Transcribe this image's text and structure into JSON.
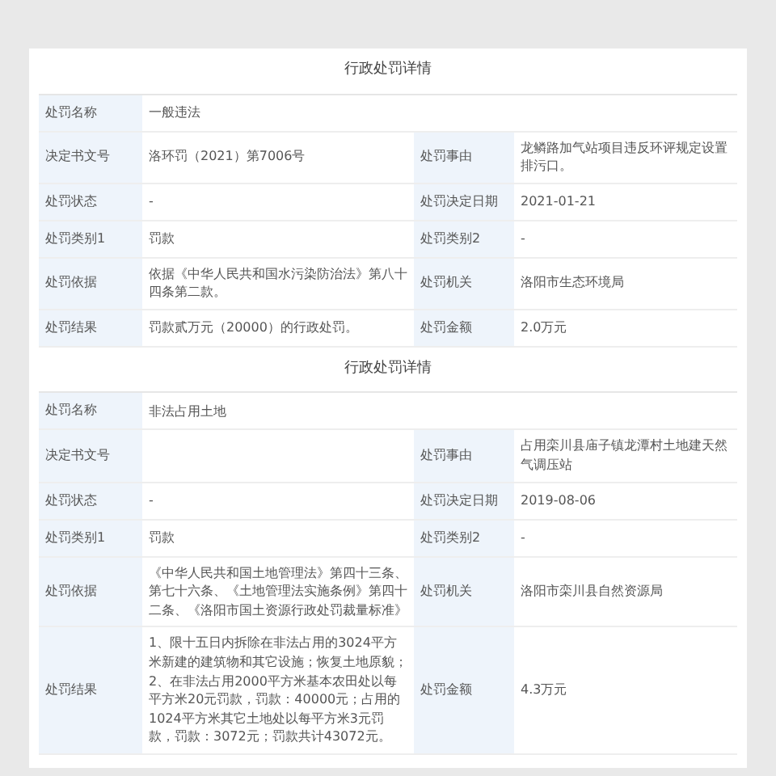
{
  "sections": [
    {
      "title": "行政处罚详情",
      "rows": [
        [
          {
            "label": "处罚名称",
            "value": "一般违法"
          }
        ],
        [
          {
            "label": "决定书文号",
            "value": "洛环罚（2021）第7006号"
          },
          {
            "label": "处罚事由",
            "value": "龙鳞路加气站项目违反环评规定设置排污口。"
          }
        ],
        [
          {
            "label": "处罚状态",
            "value": "-"
          },
          {
            "label": "处罚决定日期",
            "value": "2021-01-21"
          }
        ],
        [
          {
            "label": "处罚类别1",
            "value": "罚款"
          },
          {
            "label": "处罚类别2",
            "value": "-"
          }
        ],
        [
          {
            "label": "处罚依据",
            "value": "依据《中华人民共和国水污染防治法》第八十四条第二款。"
          },
          {
            "label": "处罚机关",
            "value": "洛阳市生态环境局"
          }
        ],
        [
          {
            "label": "处罚结果",
            "value": "罚款贰万元（20000）的行政处罚。"
          },
          {
            "label": "处罚金额",
            "value": "2.0万元"
          }
        ]
      ]
    },
    {
      "title": "行政处罚详情",
      "rows": [
        [
          {
            "label": "处罚名称",
            "value": "非法占用土地"
          }
        ],
        [
          {
            "label": "决定书文号"
          },
          {
            "label": "处罚事由",
            "value": "占用栾川县庙子镇龙潭村土地建天然气调压站"
          }
        ],
        [
          {
            "label": "处罚状态",
            "value": "-"
          },
          {
            "label": "处罚决定日期",
            "value": "2019-08-06"
          }
        ],
        [
          {
            "label": "处罚类别1",
            "value": "罚款"
          },
          {
            "label": "处罚类别2",
            "value": "-"
          }
        ],
        [
          {
            "label": "处罚依据",
            "value": "《中华人民共和国土地管理法》第四十三条、第七十六条、《土地管理法实施条例》第四十二条、《洛阳市国土资源行政处罚裁量标准》"
          },
          {
            "label": "处罚机关",
            "value": "洛阳市栾川县自然资源局"
          }
        ],
        [
          {
            "label": "处罚结果",
            "value": "1、限十五日内拆除在非法占用的3024平方米新建的建筑物和其它设施；恢复土地原貌；2、在非法占用2000平方米基本农田处以每平方米20元罚款，罚款：40000元；占用的1024平方米其它土地处以每平方米3元罚款，罚款：3072元；罚款共计43072元。"
          },
          {
            "label": "处罚金额",
            "value": "4.3万元"
          }
        ]
      ]
    }
  ]
}
